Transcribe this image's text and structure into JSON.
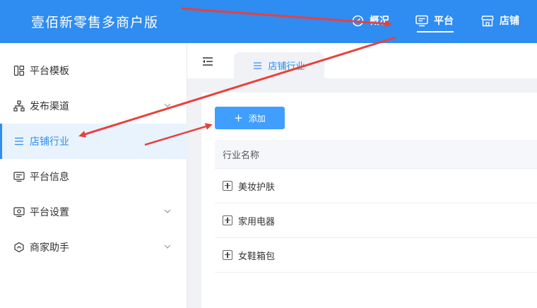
{
  "header": {
    "brand": "壹佰新零售多商户版",
    "nav": [
      {
        "label": "概况",
        "icon": "dashboard-icon"
      },
      {
        "label": "平台",
        "icon": "monitor-icon"
      },
      {
        "label": "店铺",
        "icon": "store-icon"
      }
    ],
    "active_nav": "平台"
  },
  "sidebar": {
    "items": [
      {
        "label": "平台模板",
        "icon": "template-icon",
        "has_submenu": false
      },
      {
        "label": "发布渠道",
        "icon": "channel-icon",
        "has_submenu": true
      },
      {
        "label": "店铺行业",
        "icon": "list-icon",
        "has_submenu": false,
        "active": true
      },
      {
        "label": "平台信息",
        "icon": "monitor-icon",
        "has_submenu": false
      },
      {
        "label": "平台设置",
        "icon": "settings-icon",
        "has_submenu": true
      },
      {
        "label": "商家助手",
        "icon": "assistant-icon",
        "has_submenu": true
      }
    ]
  },
  "tabs": [
    {
      "label": "店铺行业",
      "icon": "list-icon",
      "active": true
    }
  ],
  "toolbar": {
    "add_label": "添加"
  },
  "table": {
    "column": "行业名称",
    "rows": [
      "美妆护肤",
      "家用电器",
      "女鞋箱包"
    ]
  },
  "colors": {
    "primary": "#2f8cf0",
    "button": "#409eff",
    "annotation": "#e8413d"
  }
}
